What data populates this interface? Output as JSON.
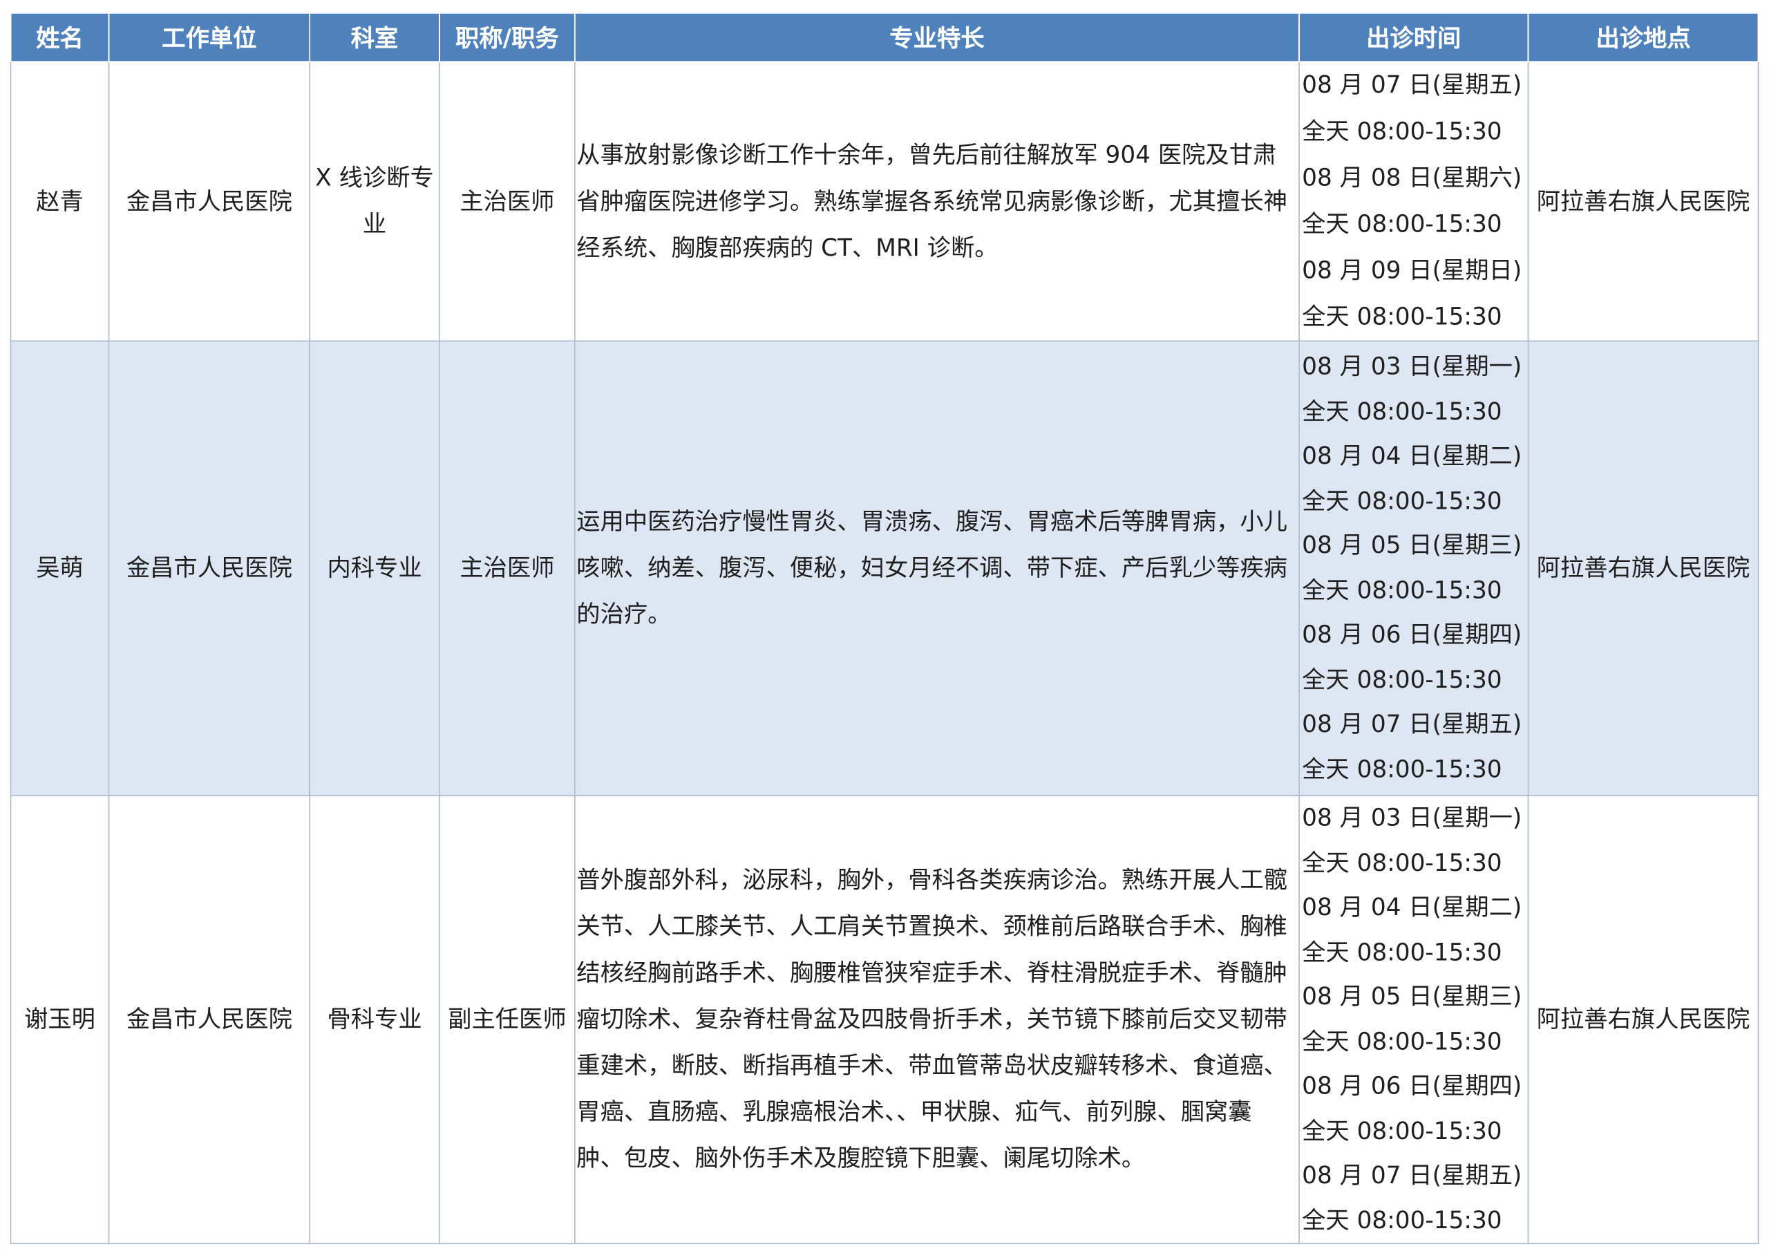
{
  "table": {
    "headers": [
      "姓名",
      "工作单位",
      "科室",
      "职称/职务",
      "专业特长",
      "出诊时间",
      "出诊地点"
    ],
    "rows": [
      {
        "name": "赵青",
        "unit": "金昌市人民医院",
        "department": "X 线诊断专业",
        "title": "主治医师",
        "specialty": "从事放射影像诊断工作十余年，曾先后前往解放军 904 医院及甘肃省肿瘤医院进修学习。熟练掌握各系统常见病影像诊断，尤其擅长神经系统、胸腹部疾病的 CT、MRI 诊断。",
        "schedule": [
          "08 月 07 日(星期五)",
          "全天 08:00-15:30",
          "08 月 08 日(星期六)",
          "全天 08:00-15:30",
          "08 月 09 日(星期日)",
          "全天 08:00-15:30"
        ],
        "location": "阿拉善右旗人民医院"
      },
      {
        "name": "吴萌",
        "unit": "金昌市人民医院",
        "department": "内科专业",
        "title": "主治医师",
        "specialty": "运用中医药治疗慢性胃炎、胃溃疡、腹泻、胃癌术后等脾胃病，小儿咳嗽、纳差、腹泻、便秘，妇女月经不调、带下症、产后乳少等疾病的治疗。",
        "schedule": [
          "08 月 03 日(星期一)",
          "全天 08:00-15:30",
          "08 月 04 日(星期二)",
          "全天 08:00-15:30",
          "08 月 05 日(星期三)",
          "全天 08:00-15:30",
          "08 月 06 日(星期四)",
          "全天 08:00-15:30",
          "08 月 07 日(星期五)",
          "全天 08:00-15:30"
        ],
        "location": "阿拉善右旗人民医院"
      },
      {
        "name": "谢玉明",
        "unit": "金昌市人民医院",
        "department": "骨科专业",
        "title": "副主任医师",
        "specialty": "普外腹部外科，泌尿科，胸外，骨科各类疾病诊治。熟练开展人工髋关节、人工膝关节、人工肩关节置换术、颈椎前后路联合手术、胸椎结核经胸前路手术、胸腰椎管狭窄症手术、脊柱滑脱症手术、脊髓肿瘤切除术、复杂脊柱骨盆及四肢骨折手术，关节镜下膝前后交叉韧带重建术，断肢、断指再植手术、带血管蒂岛状皮瓣转移术、食道癌、胃癌、直肠癌、乳腺癌根治术、、甲状腺、疝气、前列腺、腘窝囊肿、包皮、脑外伤手术及腹腔镜下胆囊、阑尾切除术。",
        "schedule": [
          "08 月 03 日(星期一)",
          "全天 08:00-15:30",
          "08 月 04 日(星期二)",
          "全天 08:00-15:30",
          "08 月 05 日(星期三)",
          "全天 08:00-15:30",
          "08 月 06 日(星期四)",
          "全天 08:00-15:30",
          "08 月 07 日(星期五)",
          "全天 08:00-15:30"
        ],
        "location": "阿拉善右旗人民医院"
      }
    ]
  },
  "colors": {
    "header_bg": "#4f81bd",
    "header_text": "#ffffff",
    "band_bg": "#dde6f3",
    "border": "#a9b8cc"
  }
}
